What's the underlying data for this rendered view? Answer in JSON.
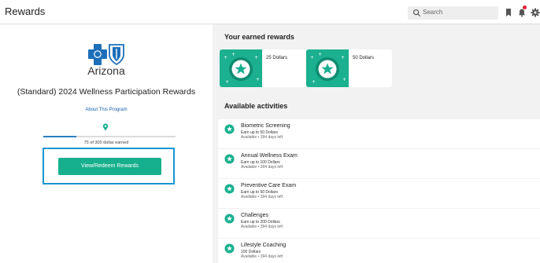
{
  "header": {
    "title": "Rewards",
    "search_placeholder": "Search"
  },
  "program": {
    "brand": "Arizona",
    "title": "(Standard) 2024 Wellness Participation Rewards",
    "about_link": "About This Program",
    "progress_fraction": 0.25,
    "earned_text": "75 of 300 dollar earned",
    "redeem_label": "View/Redeem Rewards"
  },
  "earned_rewards": {
    "heading": "Your earned rewards",
    "items": [
      {
        "label": "25 Dollars"
      },
      {
        "label": "50 Dollars"
      }
    ]
  },
  "activities": {
    "heading": "Available activities",
    "items": [
      {
        "name": "Biometric Screening",
        "earn": "Earn up to 50 Dollars",
        "avail": "Available • 394 days left"
      },
      {
        "name": "Annual Wellness Exam",
        "earn": "Earn up to 100 Dollars",
        "avail": "Available • 394 days left"
      },
      {
        "name": "Preventive Care Exam",
        "earn": "Earn up to 50 Dollars",
        "avail": "Available • 394 days left"
      },
      {
        "name": "Challenges",
        "earn": "Earn up to 200 Dollars",
        "avail": "Available • 394 days left"
      },
      {
        "name": "Lifestyle Coaching",
        "earn": "100 Dollars",
        "avail": "Available • 394 days left"
      }
    ]
  },
  "colors": {
    "accent": "#17b08e",
    "link": "#1a5fa8",
    "highlight": "#1696d2",
    "notification": "#e0213a"
  },
  "icons": [
    "search-icon",
    "bookmark-icon",
    "bell-icon",
    "gear-icon",
    "cross-shield-logo",
    "location-pin-icon",
    "star-badge-icon"
  ]
}
